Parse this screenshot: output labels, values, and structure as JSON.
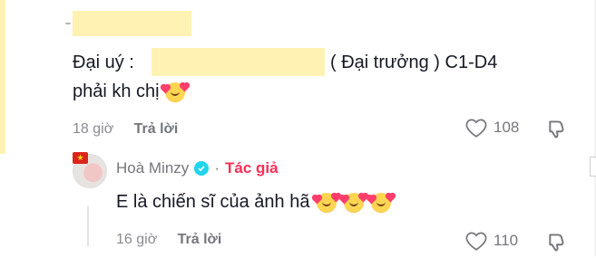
{
  "comment1": {
    "label_prefix": "Đại uý :",
    "label_suffix": "( Đại trưởng ) C1-D4",
    "line2": "phải kh chị",
    "time": "18 giờ",
    "reply": "Trả lời",
    "likes": "108"
  },
  "reply": {
    "name": "Hoà Minzy",
    "separator": "·",
    "author_badge": "Tác giả",
    "text": "E là chiến sĩ của ảnh hã",
    "time": "16 giờ",
    "reply": "Trả lời",
    "likes": "110"
  },
  "icons": {
    "heart": "heart-outline-icon",
    "dislike": "dislike-icon",
    "verified": "verified-badge-icon",
    "emoji": "smiling-face-with-hearts-icon"
  },
  "colors": {
    "redaction": "#fff2b3",
    "author": "#fe2c55",
    "meta": "#8a8b91"
  }
}
